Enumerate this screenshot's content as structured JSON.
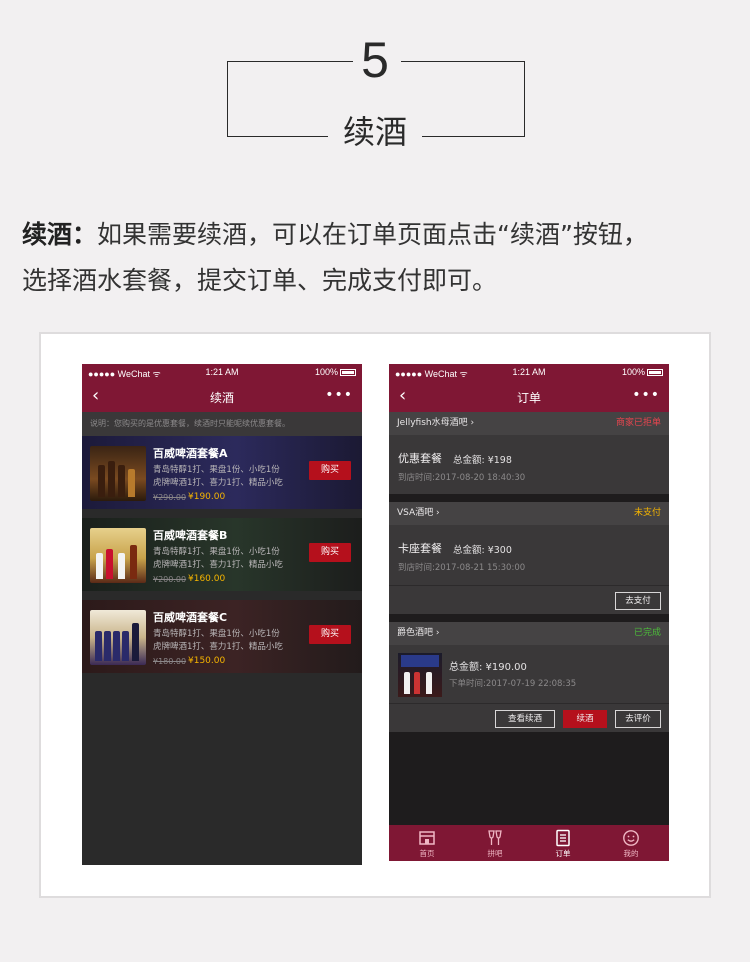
{
  "header": {
    "number": "5",
    "title": "续酒"
  },
  "description": {
    "term": "续酒：",
    "text": "如果需要续酒，可以在订单页面点击“续酒”按钮，",
    "text2": "选择酒水套餐，提交订单、完成支付即可。"
  },
  "status_bar": {
    "carrier": "●●●●● WeChat ᯤ",
    "time": "1:21 AM",
    "battery": "100%"
  },
  "left_screen": {
    "title": "续酒",
    "back": "‹",
    "more": "•••",
    "note": "说明：您购买的是优惠套餐，续酒时只能呢续优惠套餐。",
    "packages": [
      {
        "name": "百威啤酒套餐A",
        "line1": "青岛特醇1打、果盘1份、小吃1份",
        "line2": "虎牌啤酒1打、喜力1打、精品小吃",
        "old_price": "¥290.00",
        "price": "¥190.00",
        "buy": "购买"
      },
      {
        "name": "百威啤酒套餐B",
        "line1": "青岛特醇1打、果盘1份、小吃1份",
        "line2": "虎牌啤酒1打、喜力1打、精品小吃",
        "old_price": "¥200.00",
        "price": "¥160.00",
        "buy": "购买"
      },
      {
        "name": "百威啤酒套餐C",
        "line1": "青岛特醇1打、果盘1份、小吃1份",
        "line2": "虎牌啤酒1打、喜力1打、精品小吃",
        "old_price": "¥180.00",
        "price": "¥150.00",
        "buy": "购买"
      }
    ]
  },
  "right_screen": {
    "title": "订单",
    "back": "‹",
    "more": "•••",
    "orders": [
      {
        "bar": "Jellyfish水母酒吧  ›",
        "status": "商家已拒单",
        "status_color": "#e8454f",
        "title": "优惠套餐",
        "total": "总金额: ¥198",
        "time": "到店时间:2017-08-20 18:40:30"
      },
      {
        "bar": "VSA酒吧  ›",
        "status": "未支付",
        "status_color": "#f5b400",
        "title": "卡座套餐",
        "total": "总金额: ¥300",
        "time": "到店时间:2017-08-21 15:30:00",
        "pay_button": "去支付"
      },
      {
        "bar": "爵色酒吧  ›",
        "status": "已完成",
        "status_color": "#4cbb3a",
        "total": "总金额: ¥190.00",
        "time": "下单时间:2017-07-19 22:08:35",
        "view_button": "查看续酒",
        "refill_button": "续酒",
        "review_button": "去评价"
      }
    ],
    "tabs": [
      {
        "label": "首页",
        "icon": "home-icon"
      },
      {
        "label": "拼吧",
        "icon": "cheers-icon"
      },
      {
        "label": "订单",
        "icon": "order-list-icon"
      },
      {
        "label": "我的",
        "icon": "smile-face-icon"
      }
    ]
  },
  "colors": {
    "brand": "#7f1734",
    "buy": "#b5101c",
    "price": "#f5b400"
  }
}
